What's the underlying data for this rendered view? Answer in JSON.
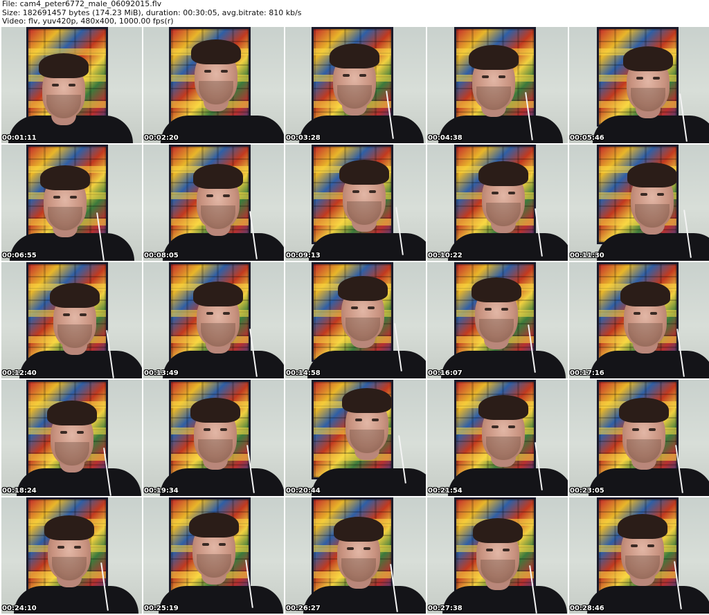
{
  "header": {
    "file_line": "File: cam4_peter6772_male_06092015.flv",
    "size_line": "Size: 182691457 bytes (174.23 MiB), duration: 00:30:05, avg.bitrate: 810 kb/s",
    "video_line": "Video: flv, yuv420p, 480x400, 1000.00 fps(r)"
  },
  "thumbnails": [
    {
      "time": "00:01:11"
    },
    {
      "time": "00:02:20"
    },
    {
      "time": "00:03:28"
    },
    {
      "time": "00:04:38"
    },
    {
      "time": "00:05:46"
    },
    {
      "time": "00:06:55"
    },
    {
      "time": "00:08:05"
    },
    {
      "time": "00:09:13"
    },
    {
      "time": "00:10:22"
    },
    {
      "time": "00:11:30"
    },
    {
      "time": "00:12:40"
    },
    {
      "time": "00:13:49"
    },
    {
      "time": "00:14:58"
    },
    {
      "time": "00:16:07"
    },
    {
      "time": "00:17:16"
    },
    {
      "time": "00:18:24"
    },
    {
      "time": "00:19:34"
    },
    {
      "time": "00:20:44"
    },
    {
      "time": "00:21:54"
    },
    {
      "time": "00:23:05"
    },
    {
      "time": "00:24:10"
    },
    {
      "time": "00:25:19"
    },
    {
      "time": "00:26:27"
    },
    {
      "time": "00:27:38"
    },
    {
      "time": "00:28:46"
    }
  ]
}
